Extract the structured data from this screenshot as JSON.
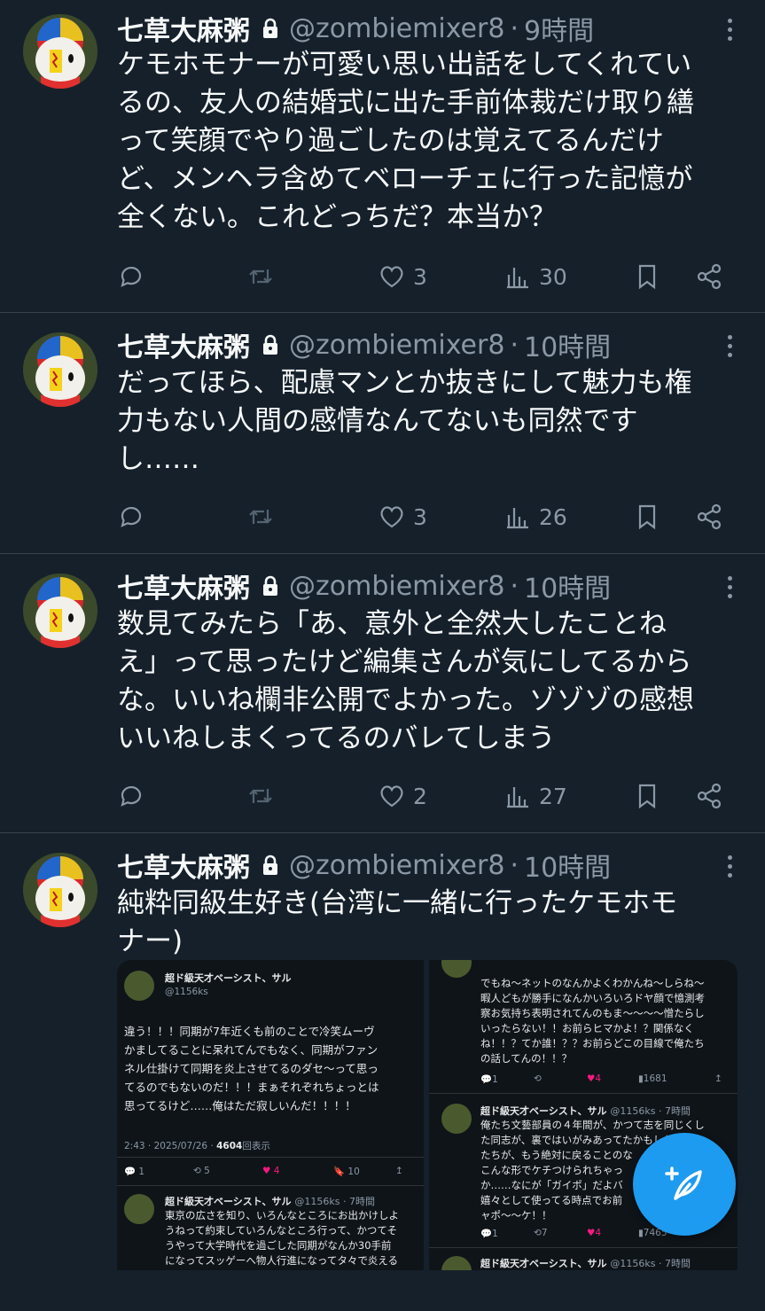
{
  "tweets": [
    {
      "name": "七草大麻粥",
      "handle": "@zombiemixer8",
      "dot": "·",
      "time": "9時間",
      "text": "ケモホモナーが可愛い思い出話をしてくれてい\nるの、友人の結婚式に出た手前体裁だけ取り繕\nって笑顔でやり過ごしたのは覚えてるんだけ\nど、メンヘラ含めてベローチェに行った記憶が\n全くない。これどっちだ？本当か？",
      "likes": "3",
      "views": "30"
    },
    {
      "name": "七草大麻粥",
      "handle": "@zombiemixer8",
      "dot": "·",
      "time": "10時間",
      "text": "だってほら、配慮マンとか抜きにして魅力も権\n力もない人間の感情なんてないも同然です\nし……",
      "likes": "3",
      "views": "26"
    },
    {
      "name": "七草大麻粥",
      "handle": "@zombiemixer8",
      "dot": "·",
      "time": "10時間",
      "text": "数見てみたら「あ、意外と全然大したことね\nえ」って思ったけど編集さんが気にしてるから\nな。いいね欄非公開でよかった。ゾゾゾの感想\nいいねしまくってるのバレてしまう",
      "likes": "2",
      "views": "27"
    },
    {
      "name": "七草大麻粥",
      "handle": "@zombiemixer8",
      "dot": "·",
      "time": "10時間",
      "text": "純粋同級生好き(台湾に一緒に行ったケモホモ\nナー)"
    }
  ],
  "media_left": {
    "top_name": "超ド級天才ベーシスト、サル",
    "top_handle": "@1156ks",
    "top_text": "違う！！！同期が7年近くも前のことで冷笑ムーヴ\nかましてることに呆れてんでもなく、同期がファン\nネル仕掛けて同期を炎上させてるのダセ〜って思っ\nてるのでもないのだ！！！まぁそれぞれちょっとは\n思ってるけど……俺はただ寂しいんだ！！！！",
    "meta_time": "2:43 · 2025/07/26 · ",
    "meta_views": "4604",
    "meta_views_label": "回表示",
    "replies": "1",
    "retweets": "5",
    "likes": "4",
    "bookmarks": "10",
    "reply_name": "超ド級天才ベーシスト、サル",
    "reply_handle": "@1156ks · 7時間",
    "reply_text": "東京の広さを知り、いろんなところにお出かけしよ\nうねって約束していろんなところ行って、かつてそ\nうやって大学時代を過ごした同期がなんか30手前\nになってスッゲーへ物人行進になってタ々で炎える"
  },
  "media_right": {
    "top_text": "でもね〜ネットのなんかよくわかんね〜しらね〜\n暇人どもが勝手になんかいろいろドヤ顔で憶測考\n察お気持ち表明されてんのもま〜〜〜〜憎たらし\nいったらない！！お前らヒマかよ！？関係なく\nね！！？てか誰！？？お前らどこの目線で俺たち\nの話してんの！！？",
    "replies": "1",
    "likes": "4",
    "views": "1681",
    "reply_name": "超ド級天才ベーシスト、サル",
    "reply_handle": "@1156ks · 7時間",
    "reply_text": "俺たち文藝部員の４年間が、かつて志を同じくし\nた同志が、裏ではいがみあってたかもしれ\nたちが、もう絶対に戻ることのな\nこんな形でケチつけられちゃっ\nか……なにが「ガイポ」だよバ\n嬉々として使ってる時点でお前\nャポ〜〜ケ！！",
    "reply_replies": "1",
    "reply_retweets": "7",
    "reply_likes": "4",
    "reply_views": "7465",
    "next_name": "超ド級天才ベーシスト、サル",
    "next_handle": "@1156ks · 7時間"
  },
  "colors": {
    "background": "#15202b",
    "text": "#f7f9f9",
    "secondary": "#8b98a5",
    "accent": "#1d9bf0",
    "like_pink": "#f91880"
  },
  "icons": [
    "lock-icon",
    "more-icon",
    "reply-icon",
    "retweet-icon",
    "like-icon",
    "views-icon",
    "bookmark-icon",
    "share-icon",
    "compose-icon"
  ]
}
